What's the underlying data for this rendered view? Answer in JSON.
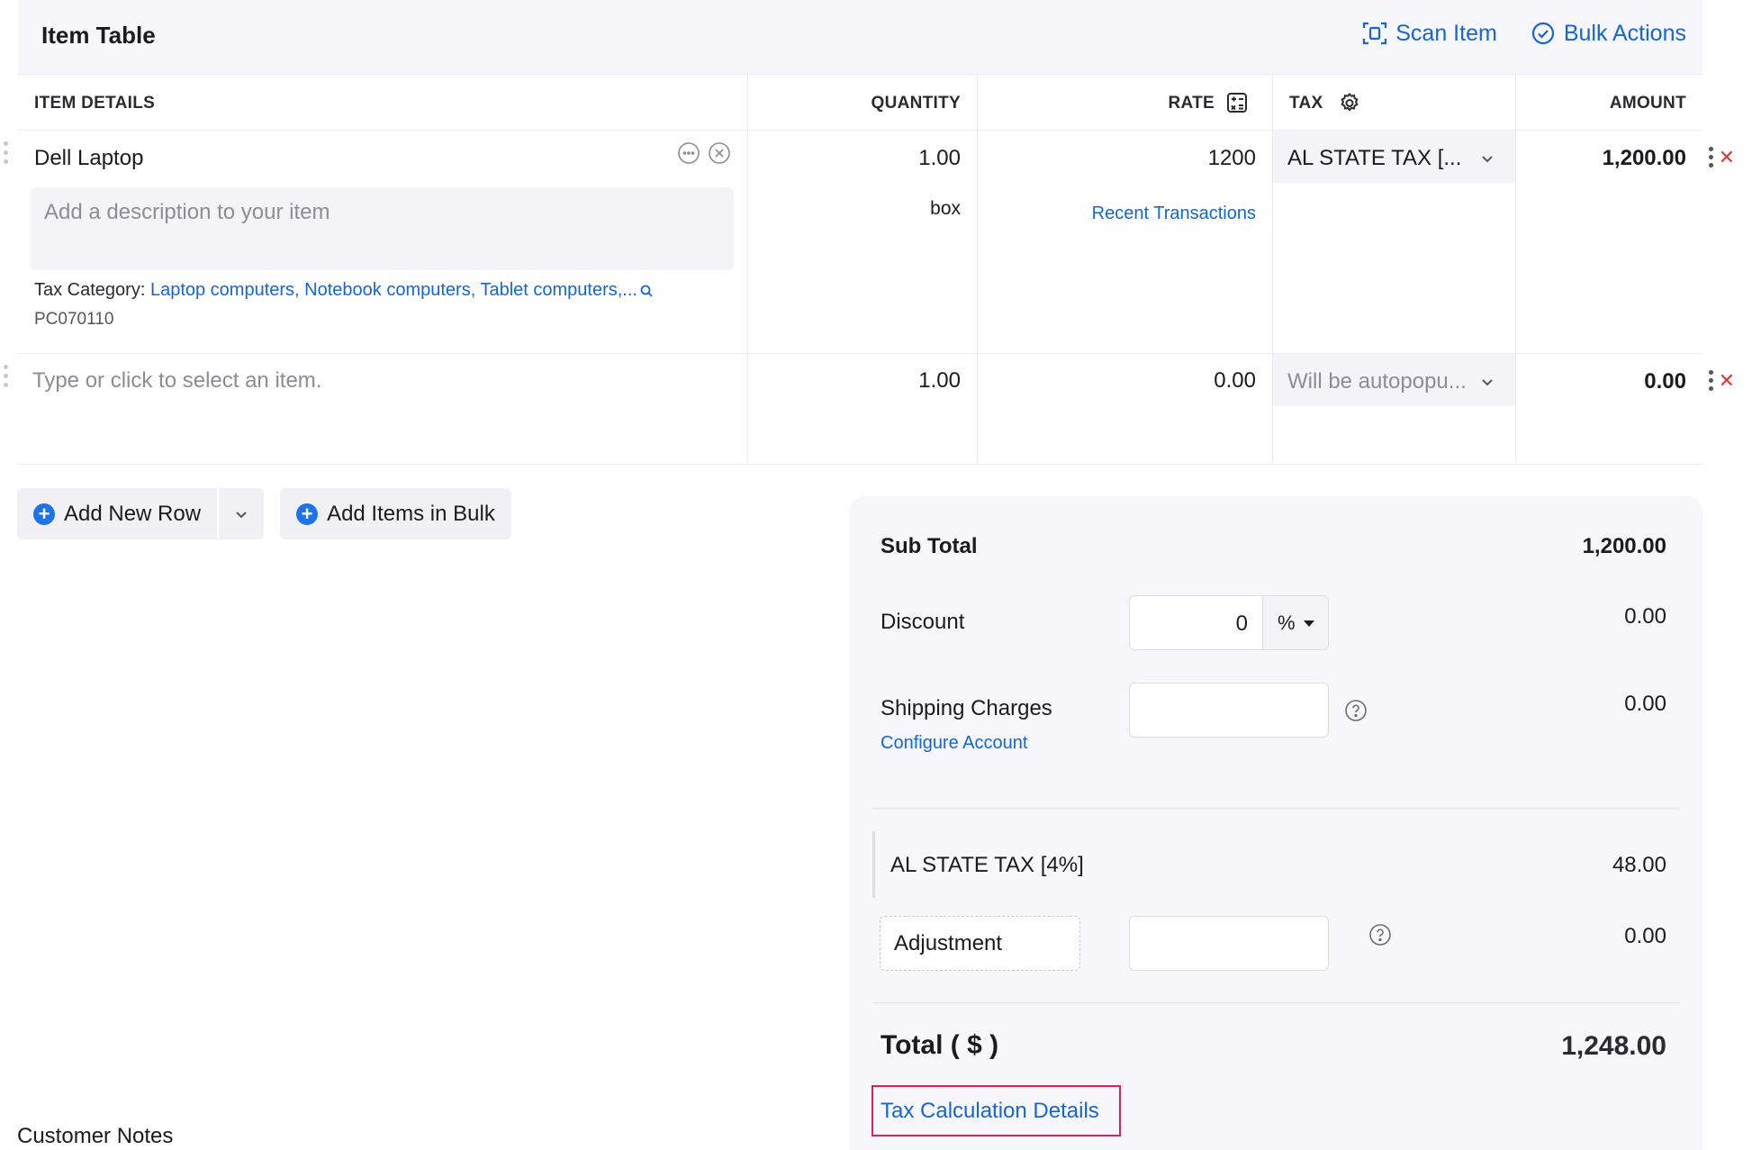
{
  "item_table": {
    "title": "Item Table",
    "scan_item_label": "Scan Item",
    "bulk_actions_label": "Bulk Actions",
    "columns": {
      "item_details": "ITEM DETAILS",
      "quantity": "QUANTITY",
      "rate": "RATE",
      "tax": "TAX",
      "amount": "AMOUNT"
    },
    "rows": [
      {
        "item_name": "Dell Laptop",
        "description_placeholder": "Add a description to your item",
        "tax_category_label": "Tax Category:",
        "tax_category_value": "Laptop computers, Notebook computers, Tablet computers,...",
        "tax_code": "PC070110",
        "quantity": "1.00",
        "unit": "box",
        "rate": "1200",
        "recent_transactions": "Recent Transactions",
        "tax": "AL STATE TAX [...",
        "amount": "1,200.00"
      },
      {
        "item_placeholder": "Type or click to select an item.",
        "quantity": "1.00",
        "rate": "0.00",
        "tax_placeholder": "Will be autopopu...",
        "amount": "0.00"
      }
    ]
  },
  "add_buttons": {
    "add_new_row": "Add New Row",
    "add_items_in_bulk": "Add Items in Bulk"
  },
  "totals": {
    "sub_total_label": "Sub Total",
    "sub_total_value": "1,200.00",
    "discount_label": "Discount",
    "discount_input": "0",
    "discount_unit": "%",
    "discount_value": "0.00",
    "shipping_label": "Shipping Charges",
    "configure_account": "Configure Account",
    "shipping_value": "0.00",
    "tax_label": "AL STATE TAX [4%]",
    "tax_value": "48.00",
    "adjustment_label": "Adjustment",
    "adjustment_value": "0.00",
    "total_label": "Total ( $ )",
    "total_value": "1,248.00",
    "tax_calc_details": "Tax Calculation Details"
  },
  "customer_notes_label": "Customer Notes",
  "colors": {
    "link": "#1565d8",
    "highlight_border": "#e0205a",
    "panel_bg": "#f7f7fb"
  }
}
